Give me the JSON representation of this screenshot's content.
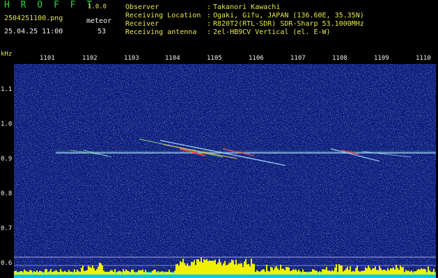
{
  "header": {
    "app_title": "H R O F F T",
    "version": "1.0.0",
    "file_name": "2504251100.png",
    "date_time": "25.04.25 11:00",
    "meteor_label": "meteor",
    "meteor_count": "53",
    "info": [
      {
        "label": "Observer",
        "value": "Takanori Kawachi"
      },
      {
        "label": "Receiving Location",
        "value": "Ogaki, Gifu, JAPAN (136.60E, 35.35N)"
      },
      {
        "label": "Receiver",
        "value": "R820T2(RTL-SDR) SDR-Sharp 53.1000MHz"
      },
      {
        "label": "Receiving antenna",
        "value": "2el-HB9CV Vertical (el. E-W)"
      }
    ],
    "separator": ":"
  },
  "axes": {
    "y_unit": "kHz",
    "y_ticks": [
      "1.1",
      "1.0",
      "0.9",
      "0.8",
      "0.7",
      "0.6"
    ],
    "x_ticks": [
      "1101",
      "1102",
      "1103",
      "1104",
      "1105",
      "1106",
      "1107",
      "1108",
      "1109",
      "1110"
    ]
  },
  "colors": {
    "background": "#000000",
    "plot_bg": "#0a1a7a",
    "green": "#31d13b",
    "yellow": "#e8e84a",
    "white": "#f0f0f0"
  }
}
